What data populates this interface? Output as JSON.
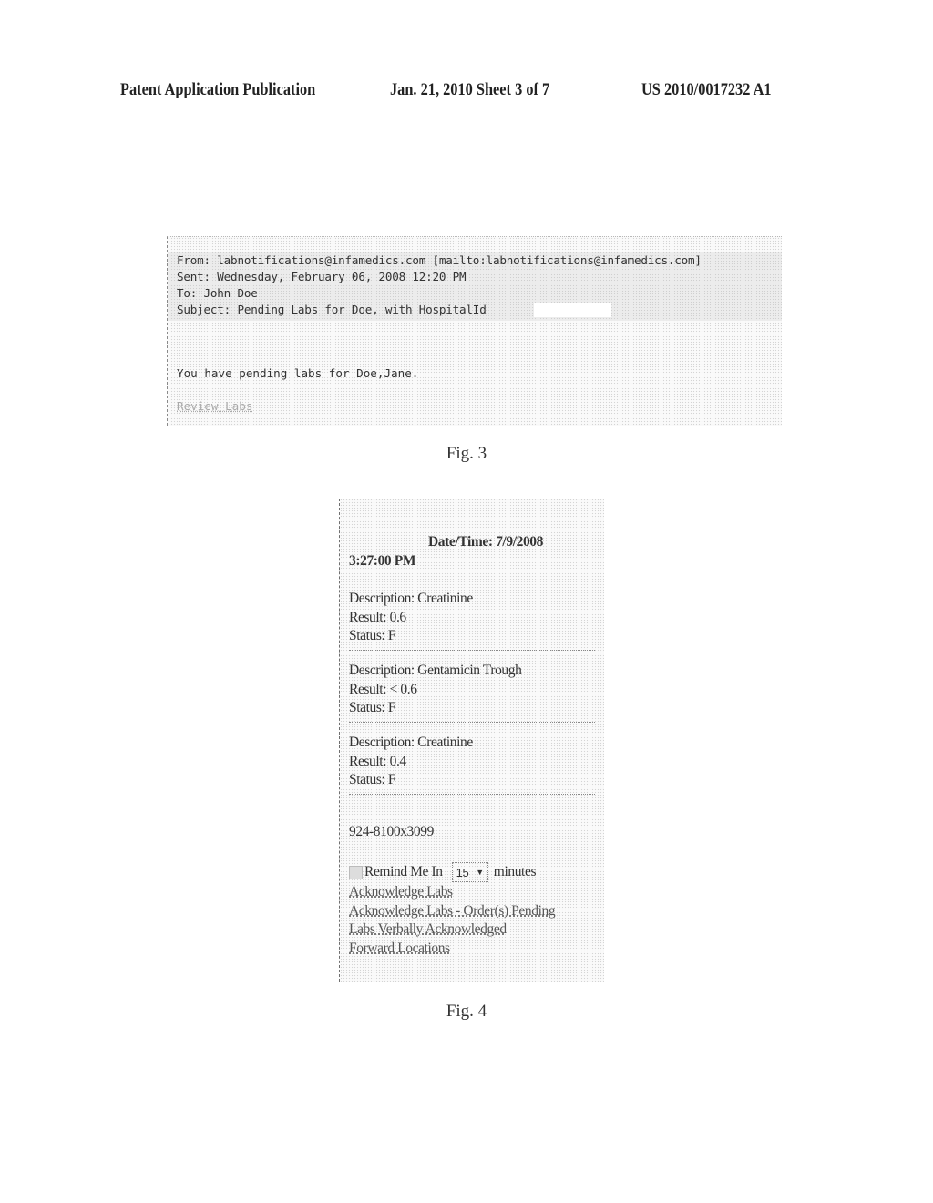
{
  "header": {
    "publication": "Patent Application Publication",
    "date_sheet": "Jan. 21, 2010  Sheet 3 of 7",
    "number": "US 2010/0017232 A1"
  },
  "fig3": {
    "caption": "Fig. 3",
    "email": {
      "from_line": "From: labnotifications@infamedics.com [mailto:labnotifications@infamedics.com]",
      "sent_line": "Sent: Wednesday, February 06, 2008 12:20 PM",
      "to_line": "To: John Doe",
      "subject_line": "Subject: Pending Labs for Doe, with HospitalId",
      "body": "You have pending labs for Doe,Jane.",
      "link": "Review Labs"
    }
  },
  "fig4": {
    "caption": "Fig. 4",
    "datetime_label": "Date/Time: 7/9/2008",
    "datetime_time": "3:27:00 PM",
    "records": [
      {
        "description": "Description: Creatinine",
        "result": "Result: 0.6",
        "status": "Status: F"
      },
      {
        "description": "Description: Gentamicin Trough",
        "result": "Result: < 0.6",
        "status": "Status: F"
      },
      {
        "description": "Description: Creatinine",
        "result": "Result: 0.4",
        "status": "Status: F"
      }
    ],
    "phone": "924-8100x3099",
    "remind": {
      "label": "Remind Me In",
      "selected": "15",
      "suffix": "minutes"
    },
    "links": [
      "Acknowledge Labs",
      "Acknowledge Labs - Order(s) Pending",
      "Labs Verbally Acknowledged",
      "Forward Locations"
    ]
  }
}
